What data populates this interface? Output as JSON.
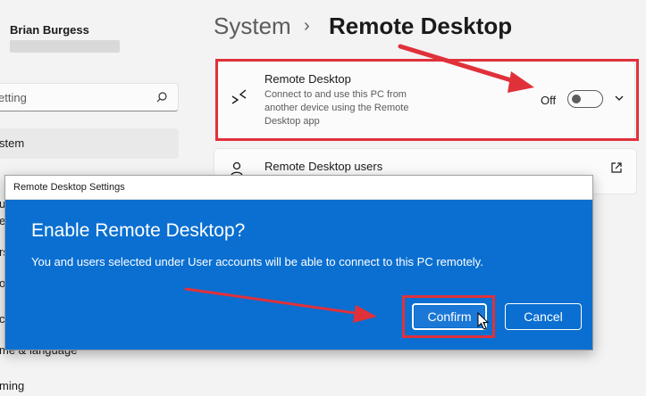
{
  "sidebar": {
    "user_name": "Brian Burgess",
    "search_placeholder": "etting",
    "items": [
      {
        "label": "stem"
      },
      {
        "label": "ue"
      },
      {
        "label": "et"
      },
      {
        "label": "rs"
      },
      {
        "label": "op"
      },
      {
        "label": "c"
      },
      {
        "label": "me & language"
      },
      {
        "label": "ming"
      }
    ]
  },
  "header": {
    "parent": "System",
    "separator": "›",
    "current": "Remote Desktop"
  },
  "remote_desktop_card": {
    "title": "Remote Desktop",
    "description": "Connect to and use this PC from another device using the Remote Desktop app",
    "toggle_label": "Off",
    "toggle_state": "off"
  },
  "users_card": {
    "title": "Remote Desktop users"
  },
  "dialog": {
    "window_title": "Remote Desktop Settings",
    "heading": "Enable Remote Desktop?",
    "message": "You and users selected under User accounts will be able to connect to this PC remotely.",
    "confirm_label": "Confirm",
    "cancel_label": "Cancel"
  },
  "colors": {
    "dialog_blue": "#0a6fd1",
    "annotation_red": "#e0313a"
  }
}
